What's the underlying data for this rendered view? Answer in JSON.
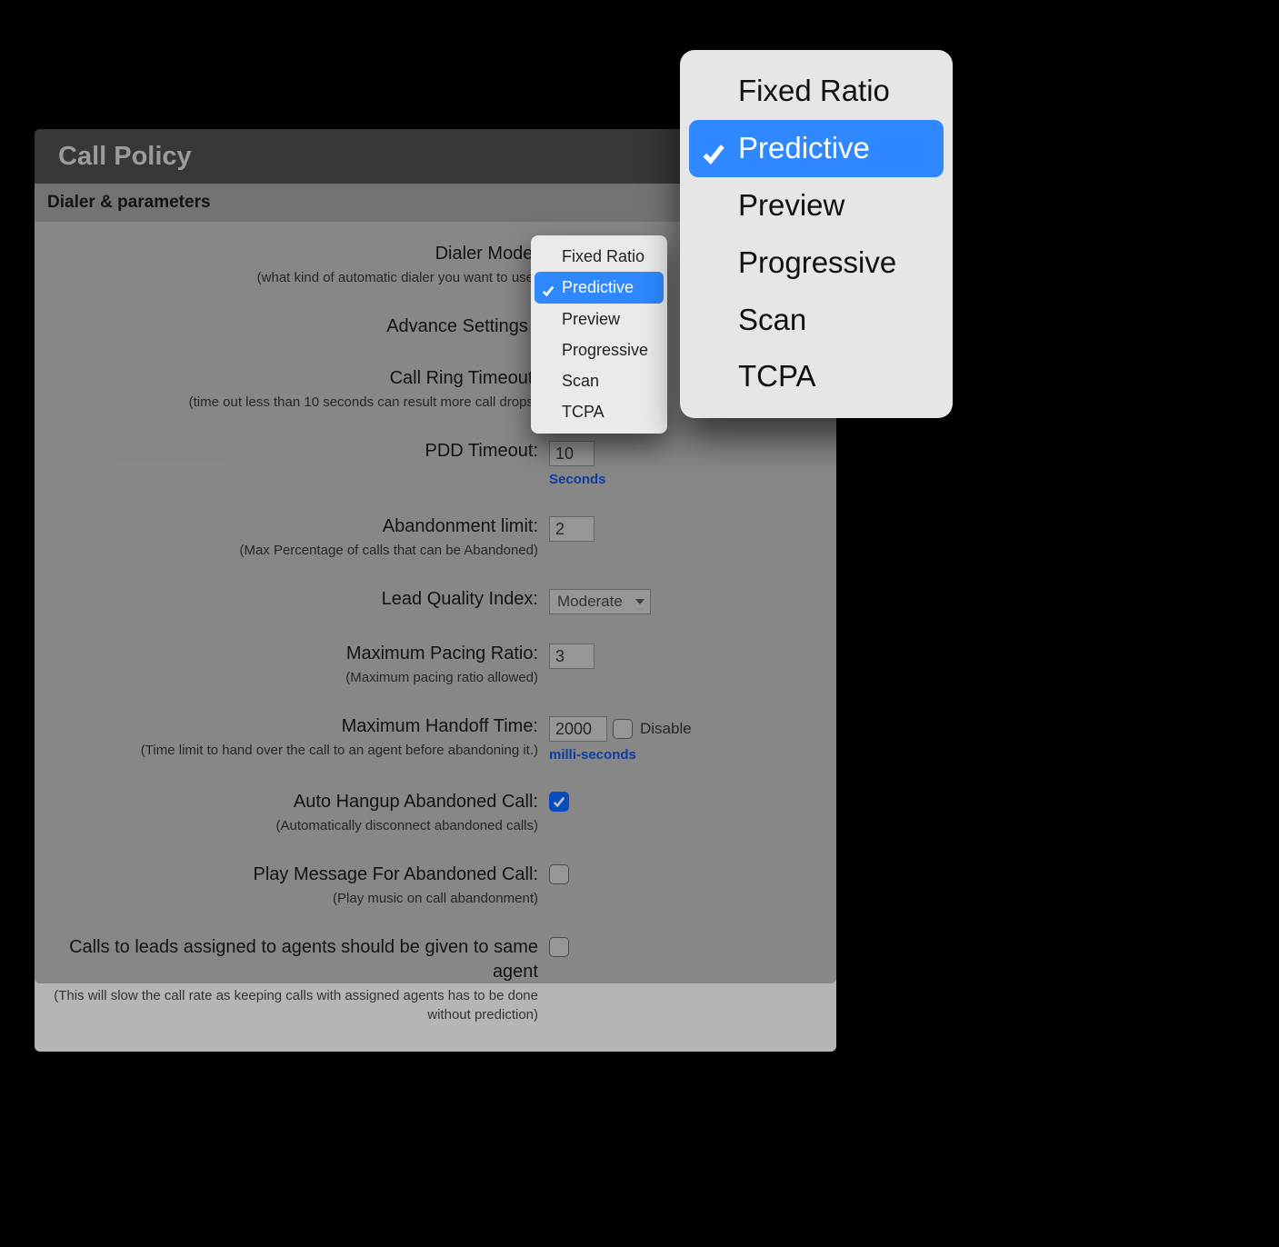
{
  "panel": {
    "title": "Call Policy",
    "section": "Dialer & parameters"
  },
  "units": {
    "seconds": "Seconds",
    "ms": "milli-seconds"
  },
  "fields": {
    "dialer_mode": {
      "label": "Dialer Mode:",
      "hint": "(what kind of automatic dialer you want to use)"
    },
    "advance_settings": {
      "label": "Advance Settings :"
    },
    "call_ring_timeout": {
      "label": "Call Ring Timeout:",
      "hint": "(time out less than 10 seconds can result more call drops)"
    },
    "pdd_timeout": {
      "label": "PDD Timeout:",
      "value": "10"
    },
    "abandon_limit": {
      "label": "Abandonment limit:",
      "hint": "(Max Percentage of calls that can be Abandoned)",
      "value": "2"
    },
    "lead_quality": {
      "label": "Lead Quality Index:",
      "value": "Moderate"
    },
    "max_pacing": {
      "label": "Maximum Pacing Ratio:",
      "hint": "(Maximum pacing ratio allowed)",
      "value": "3"
    },
    "max_handoff": {
      "label": "Maximum Handoff Time:",
      "hint": "(Time limit to hand over the call to an agent before abandoning it.)",
      "value": "2000",
      "disable_label": "Disable"
    },
    "auto_hangup": {
      "label": "Auto Hangup Abandoned Call:",
      "hint": "(Automatically disconnect abandoned calls)"
    },
    "play_msg": {
      "label": "Play Message For Abandoned Call:",
      "hint": "(Play music on call abandonment)"
    },
    "same_agent": {
      "label": "Calls to leads assigned to agents should be given to same agent",
      "hint": "(This will slow the call rate as keeping calls with assigned agents has to be done without prediction)"
    }
  },
  "dropdown": {
    "options": [
      "Fixed Ratio",
      "Predictive",
      "Preview",
      "Progressive",
      "Scan",
      "TCPA"
    ],
    "selected_index": 1
  }
}
